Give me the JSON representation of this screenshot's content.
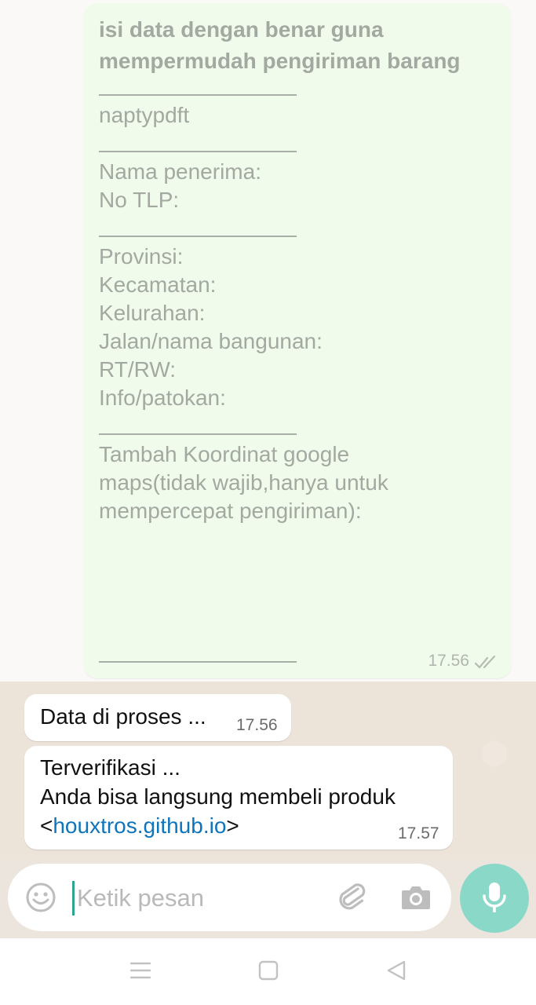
{
  "outgoing": {
    "header_line1": "isi data dengan benar guna",
    "header_line2": "mempermudah pengiriman barang",
    "code": "naptypdft",
    "recipient_name": "Nama penerima:",
    "phone": "No TLP:",
    "province": "Provinsi:",
    "district": "Kecamatan:",
    "subdistrict": "Kelurahan:",
    "street": "Jalan/nama bangunan:",
    "rtrw": "RT/RW:",
    "info": "Info/patokan:",
    "coords_line1": "Tambah Koordinat google",
    "coords_line2": "maps(tidak wajib,hanya untuk",
    "coords_line3": "mempercepat pengiriman):",
    "time": "17.56",
    "status": "read"
  },
  "incoming": [
    {
      "text": "Data di proses ...",
      "time": "17.56"
    },
    {
      "line1": "Terverifikasi ...",
      "line2": "Anda bisa langsung membeli produk",
      "bracket_open": "<",
      "link": "houxtros.github.io",
      "bracket_close": ">",
      "time": "17.57"
    }
  ],
  "composer": {
    "placeholder": "Ketik pesan",
    "icons": [
      "emoji-icon",
      "attach-icon",
      "camera-icon",
      "mic-icon"
    ]
  },
  "navbar": {
    "icons": [
      "menu-icon",
      "home-icon",
      "back-icon"
    ]
  },
  "colors": {
    "outgoing_bubble": "#F1FBEC",
    "accent": "#2FA58E",
    "mic_button": "#8AD8C7",
    "link": "#0E74BC",
    "chat_background": "#EDE4D9"
  }
}
